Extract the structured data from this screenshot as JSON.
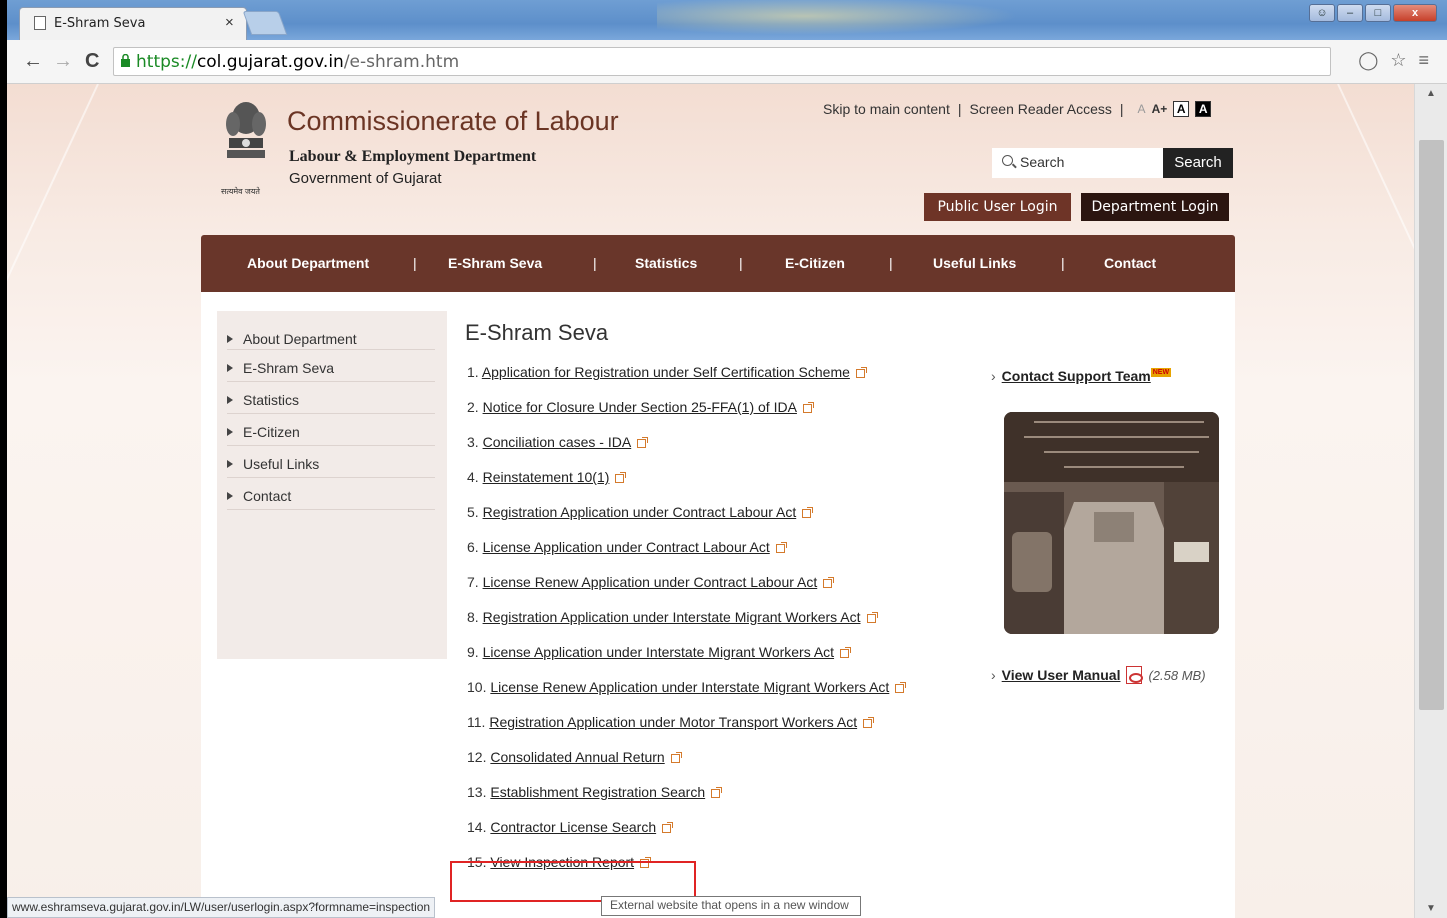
{
  "browser": {
    "tab_title": "E-Shram Seva",
    "tab_close": "×",
    "url_proto": "https://",
    "url_host": "col.gujarat.gov.in",
    "url_path": "/e-shram.htm",
    "status_url": "www.eshramseva.gujarat.gov.in/LW/user/userlogin.aspx?formname=inspection",
    "tooltip": "External website that opens in a new window"
  },
  "header": {
    "title": "Commissionerate of Labour",
    "department": "Labour & Employment Department",
    "government": "Government of Gujarat",
    "emblem_text": "सत्यमेव जयते",
    "skip_link": "Skip to main content",
    "screen_reader": "Screen Reader Access",
    "font_small": "A",
    "font_large": "A+",
    "contrast_white": "A",
    "contrast_black": "A",
    "search_placeholder": "Search",
    "search_button": "Search",
    "public_login": "Public User Login",
    "department_login": "Department Login"
  },
  "nav": {
    "items": [
      "About Department",
      "E-Shram Seva",
      "Statistics",
      "E-Citizen",
      "Useful Links",
      "Contact"
    ]
  },
  "sidebar": {
    "items": [
      "About Department",
      "E-Shram Seva",
      "Statistics",
      "E-Citizen",
      "Useful Links",
      "Contact"
    ]
  },
  "main": {
    "heading": "E-Shram Seva",
    "links": [
      {
        "num": "1.",
        "label": "Application for Registration under Self Certification Scheme"
      },
      {
        "num": "2.",
        "label": "Notice for Closure Under Section 25-FFA(1) of IDA"
      },
      {
        "num": "3.",
        "label": "Conciliation cases - IDA"
      },
      {
        "num": "4.",
        "label": "Reinstatement 10(1)"
      },
      {
        "num": "5.",
        "label": "Registration Application under Contract Labour Act"
      },
      {
        "num": "6.",
        "label": "License Application under Contract Labour Act"
      },
      {
        "num": "7.",
        "label": "License Renew Application under Contract Labour Act"
      },
      {
        "num": "8.",
        "label": "Registration Application under Interstate Migrant Workers Act"
      },
      {
        "num": "9.",
        "label": "License Application under Interstate Migrant Workers Act"
      },
      {
        "num": "10.",
        "label": "License Renew Application under Interstate Migrant Workers Act"
      },
      {
        "num": "11.",
        "label": "Registration Application under Motor Transport Workers Act"
      },
      {
        "num": "12.",
        "label": "Consolidated Annual Return"
      },
      {
        "num": "13.",
        "label": "Establishment Registration Search"
      },
      {
        "num": "14.",
        "label": "Contractor License Search"
      },
      {
        "num": "15.",
        "label": "View Inspection Report"
      }
    ]
  },
  "right": {
    "support_label": "Contact Support Team",
    "new_badge": "NEW",
    "manual_label": "View User Manual",
    "manual_size": "(2.58 MB)"
  },
  "colors": {
    "nav_bg": "#69362a",
    "dept_login_bg": "#2b1510",
    "public_login_bg": "#6e3427",
    "highlight_box": "#e02424"
  }
}
